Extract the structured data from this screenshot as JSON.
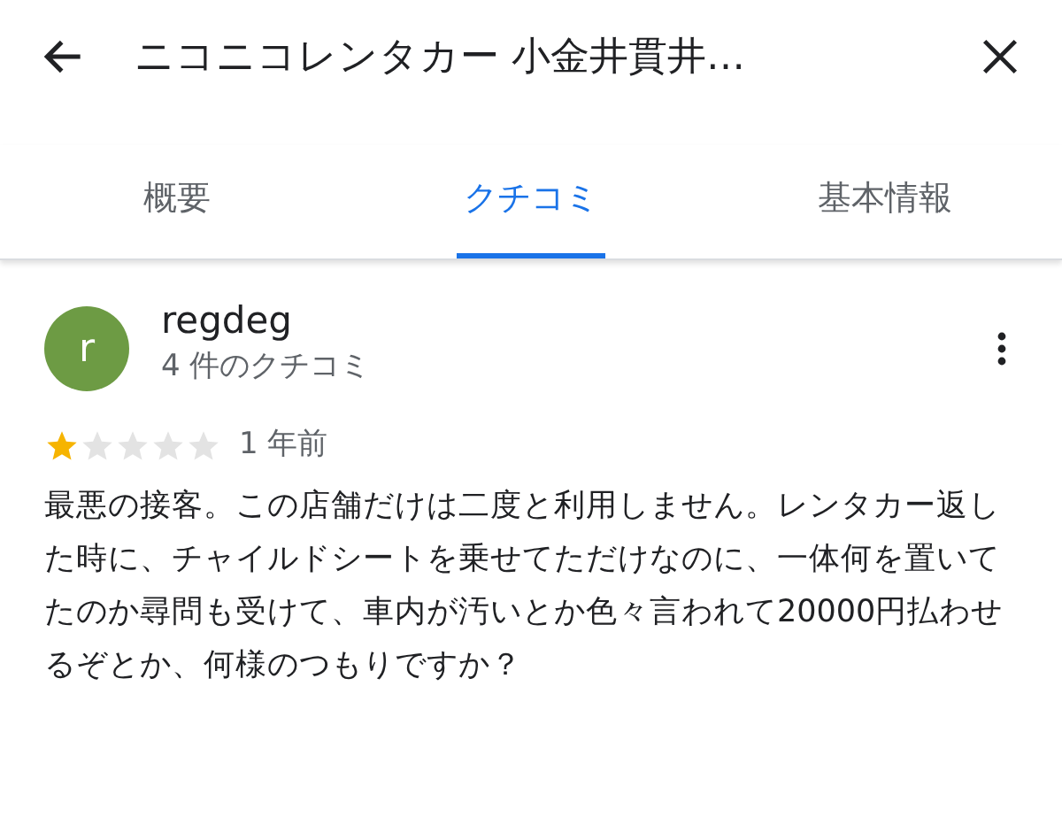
{
  "header": {
    "title": "ニコニコレンタカー 小金井貫井…"
  },
  "tabs": [
    {
      "label": "概要",
      "selected": false
    },
    {
      "label": "クチコミ",
      "selected": true
    },
    {
      "label": "基本情報",
      "selected": false
    }
  ],
  "review": {
    "avatar_letter": "r",
    "author": "regdeg",
    "review_count": "4 件のクチコミ",
    "stars": 1,
    "time": "1 年前",
    "text": "最悪の接客。この店舗だけは二度と利用しません。レンタカー返した時に、チャイルドシートを乗せてただけなのに、一体何を置いてたのか尋問も受けて、車内が汚いとか色々言われて20000円払わせるぞとか、何様のつもりですか？"
  }
}
